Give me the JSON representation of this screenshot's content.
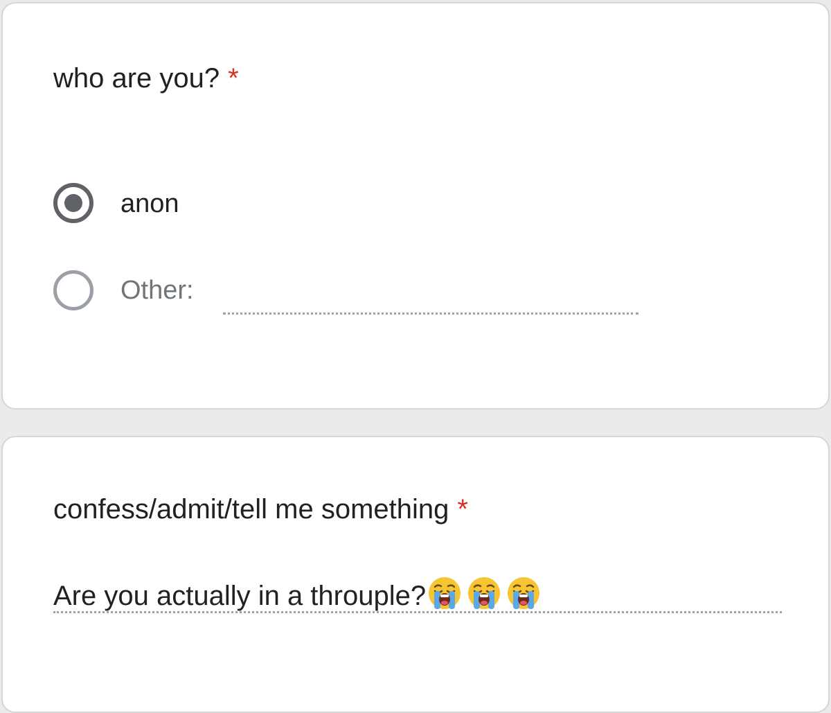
{
  "form": {
    "question1": {
      "title": "who are you?",
      "required_mark": "*",
      "options": [
        {
          "label": "anon",
          "selected": true
        },
        {
          "label": "Other:",
          "selected": false
        }
      ],
      "other_value": ""
    },
    "question2": {
      "title": "confess/admit/tell me something",
      "required_mark": "*",
      "answer_text": "Are you actually in a throuple?",
      "answer_emojis": [
        "loudly-crying-face",
        "loudly-crying-face",
        "loudly-crying-face"
      ]
    }
  },
  "colors": {
    "required": "#d93025",
    "radio_selected": "#5f6368",
    "radio_unselected": "#9aa0a6",
    "background": "#ebebeb",
    "card": "#ffffff"
  }
}
